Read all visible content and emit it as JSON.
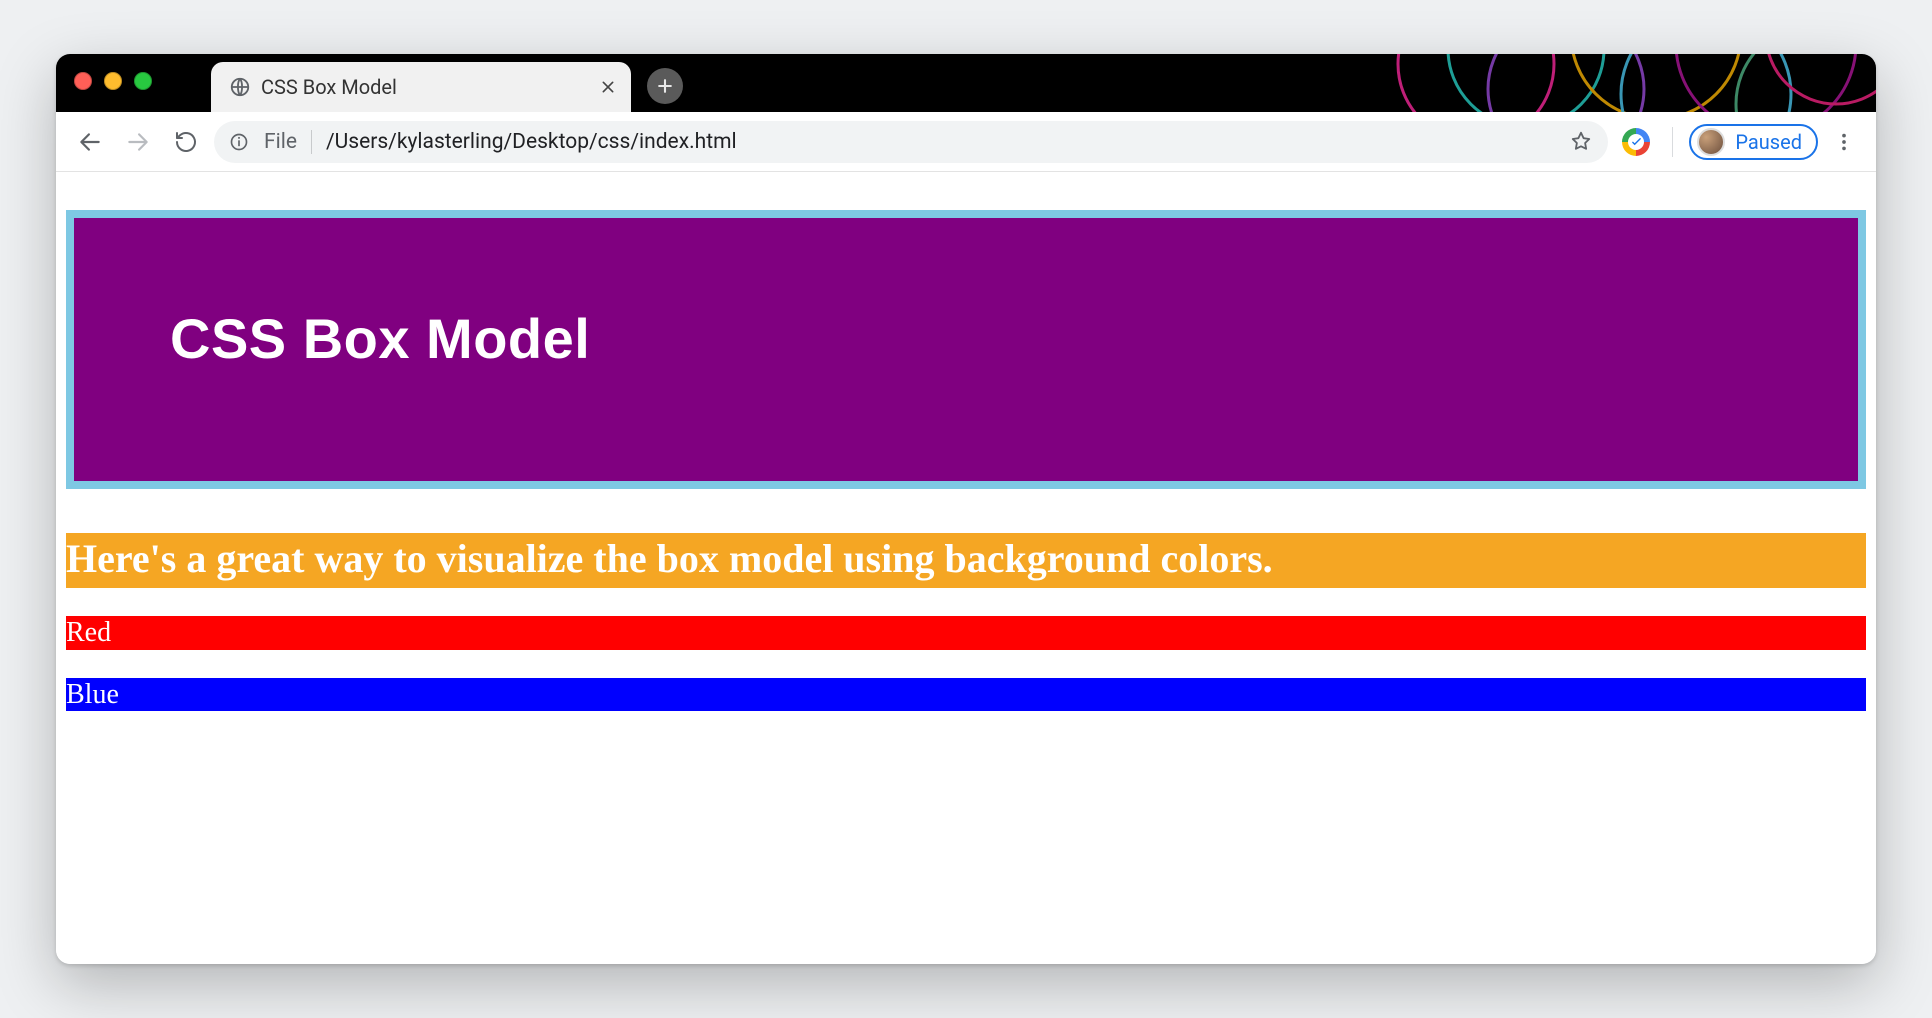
{
  "browser": {
    "tab_title": "CSS Box Model",
    "url_scheme_label": "File",
    "url_path": "/Users/kylasterling/Desktop/css/index.html",
    "profile_status": "Paused"
  },
  "page": {
    "h1": "CSS Box Model",
    "h2": "Here's a great way to visualize the box model using background colors.",
    "p_red": "Red",
    "p_blue": "Blue"
  },
  "colors": {
    "h1_bg": "#800080",
    "h1_border": "#7ec8e3",
    "h2_bg": "#f5a623",
    "red": "#ff0000",
    "blue": "#0000ff"
  }
}
